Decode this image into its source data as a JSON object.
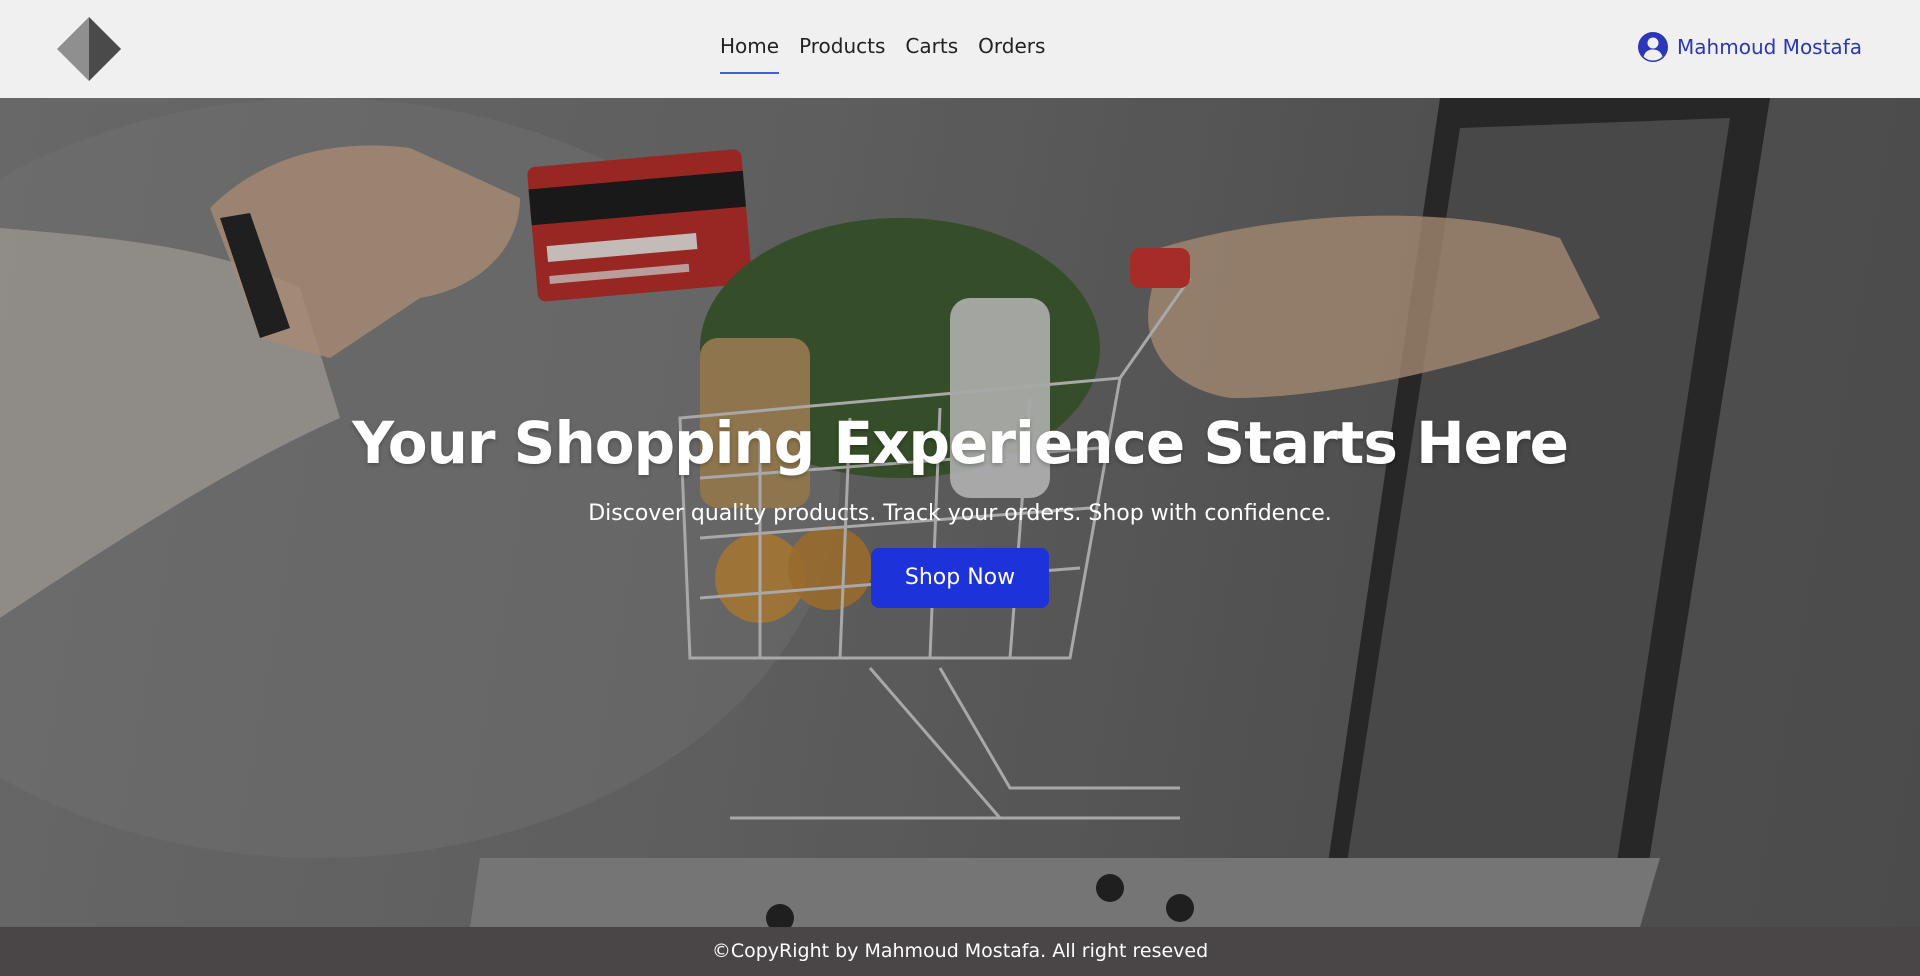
{
  "header": {
    "nav": [
      {
        "label": "Home",
        "active": true
      },
      {
        "label": "Products"
      },
      {
        "label": "Carts"
      },
      {
        "label": "Orders"
      }
    ],
    "user": {
      "name": "Mahmoud Mostafa",
      "icon": "user-circle-icon"
    },
    "logo": {
      "icon": "diamond-logo-icon"
    }
  },
  "hero": {
    "title": "Your Shopping Experience Starts Here",
    "subtitle": "Discover quality products. Track your orders. Shop with confidence.",
    "button_label": "Shop Now"
  },
  "footer": {
    "text": "©CopyRight by Mahmoud Mostafa. All right reseved"
  },
  "colors": {
    "accent": "#1d32d8",
    "user_link": "#2c36b8",
    "nav_underline": "#4a5bd8",
    "header_bg": "#f0f0f0",
    "footer_bg": "#4a4546"
  }
}
